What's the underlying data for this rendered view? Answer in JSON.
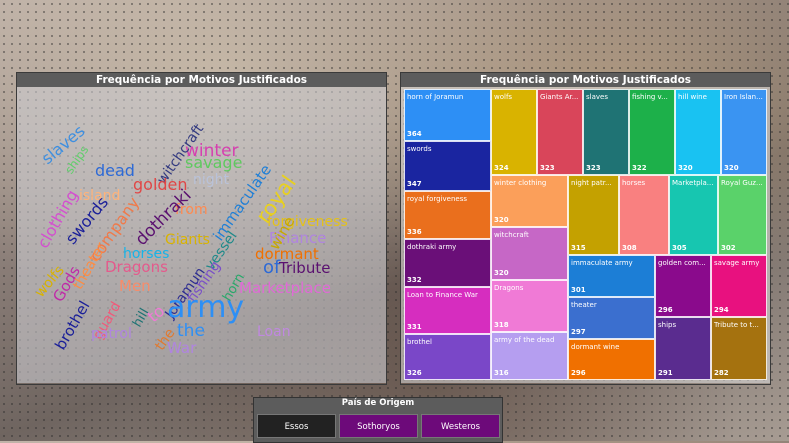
{
  "wordcloud": {
    "title": "Frequência por Motivos Justificados",
    "words": [
      "winter",
      "slaves",
      "ships",
      "dead",
      "witchcraft",
      "savage",
      "night",
      "island",
      "golden",
      "immaculate",
      "royal",
      "from",
      "forgiveness",
      "clothing",
      "swords",
      "company",
      "dothraki",
      "Finance",
      "wine",
      "vessel",
      "Giants",
      "horses",
      "dormant",
      "wolfs",
      "Gods",
      "Dragons",
      "horn",
      "of",
      "Tribute",
      "theater",
      "fishing",
      "Joramun",
      "Men",
      "Marketplace",
      "brothel",
      "hill",
      "army",
      "guard",
      "to",
      "patrol",
      "the",
      "Loan",
      "War",
      "the"
    ]
  },
  "treemap": {
    "title": "Frequência por Motivos Justificados",
    "tiles": [
      {
        "label": "horn of Joramun",
        "value": "364",
        "color": "#2d8ff5"
      },
      {
        "label": "wolfs",
        "value": "324",
        "color": "#d9b300"
      },
      {
        "label": "Giants Ar...",
        "value": "323",
        "color": "#d9455a"
      },
      {
        "label": "slaves",
        "value": "323",
        "color": "#1f7374"
      },
      {
        "label": "fishing v...",
        "value": "322",
        "color": "#1db04a"
      },
      {
        "label": "hill wine",
        "value": "320",
        "color": "#19c2f2"
      },
      {
        "label": "Iron Islan...",
        "value": "320",
        "color": "#3a94f2"
      },
      {
        "label": "swords",
        "value": "347",
        "color": "#1a25a0"
      },
      {
        "label": "winter clothing",
        "value": "320",
        "color": "#fb9f5a"
      },
      {
        "label": "night patr...",
        "value": "315",
        "color": "#c4a100"
      },
      {
        "label": "horses",
        "value": "308",
        "color": "#f98080"
      },
      {
        "label": "Marketpla...",
        "value": "305",
        "color": "#17c6b0"
      },
      {
        "label": "Royal Guz...",
        "value": "302",
        "color": "#5ad26a"
      },
      {
        "label": "royal forgiveness",
        "value": "336",
        "color": "#ea6f1d"
      },
      {
        "label": "witchcraft",
        "value": "320",
        "color": "#c667c6"
      },
      {
        "label": "dothraki army",
        "value": "332",
        "color": "#6a0f78"
      },
      {
        "label": "immaculate army",
        "value": "301",
        "color": "#1c7ed6"
      },
      {
        "label": "golden com...",
        "value": "296",
        "color": "#8a0a8c"
      },
      {
        "label": "savage army",
        "value": "294",
        "color": "#e8117f"
      },
      {
        "label": "Dragons",
        "value": "318",
        "color": "#f07ad6"
      },
      {
        "label": "theater",
        "value": "297",
        "color": "#3b6fcf"
      },
      {
        "label": "Loan to Finance War",
        "value": "331",
        "color": "#d62dbf"
      },
      {
        "label": "ships",
        "value": "291",
        "color": "#5a2c8f"
      },
      {
        "label": "Tribute to t...",
        "value": "282",
        "color": "#a5720f"
      },
      {
        "label": "army of the dead",
        "value": "316",
        "color": "#b59ef0"
      },
      {
        "label": "dormant wine",
        "value": "296",
        "color": "#f07000"
      },
      {
        "label": "brothel",
        "value": "326",
        "color": "#7a47c8"
      }
    ]
  },
  "slicer": {
    "title": "País de Origem",
    "options": [
      "Essos",
      "Sothoryos",
      "Westeros"
    ]
  }
}
